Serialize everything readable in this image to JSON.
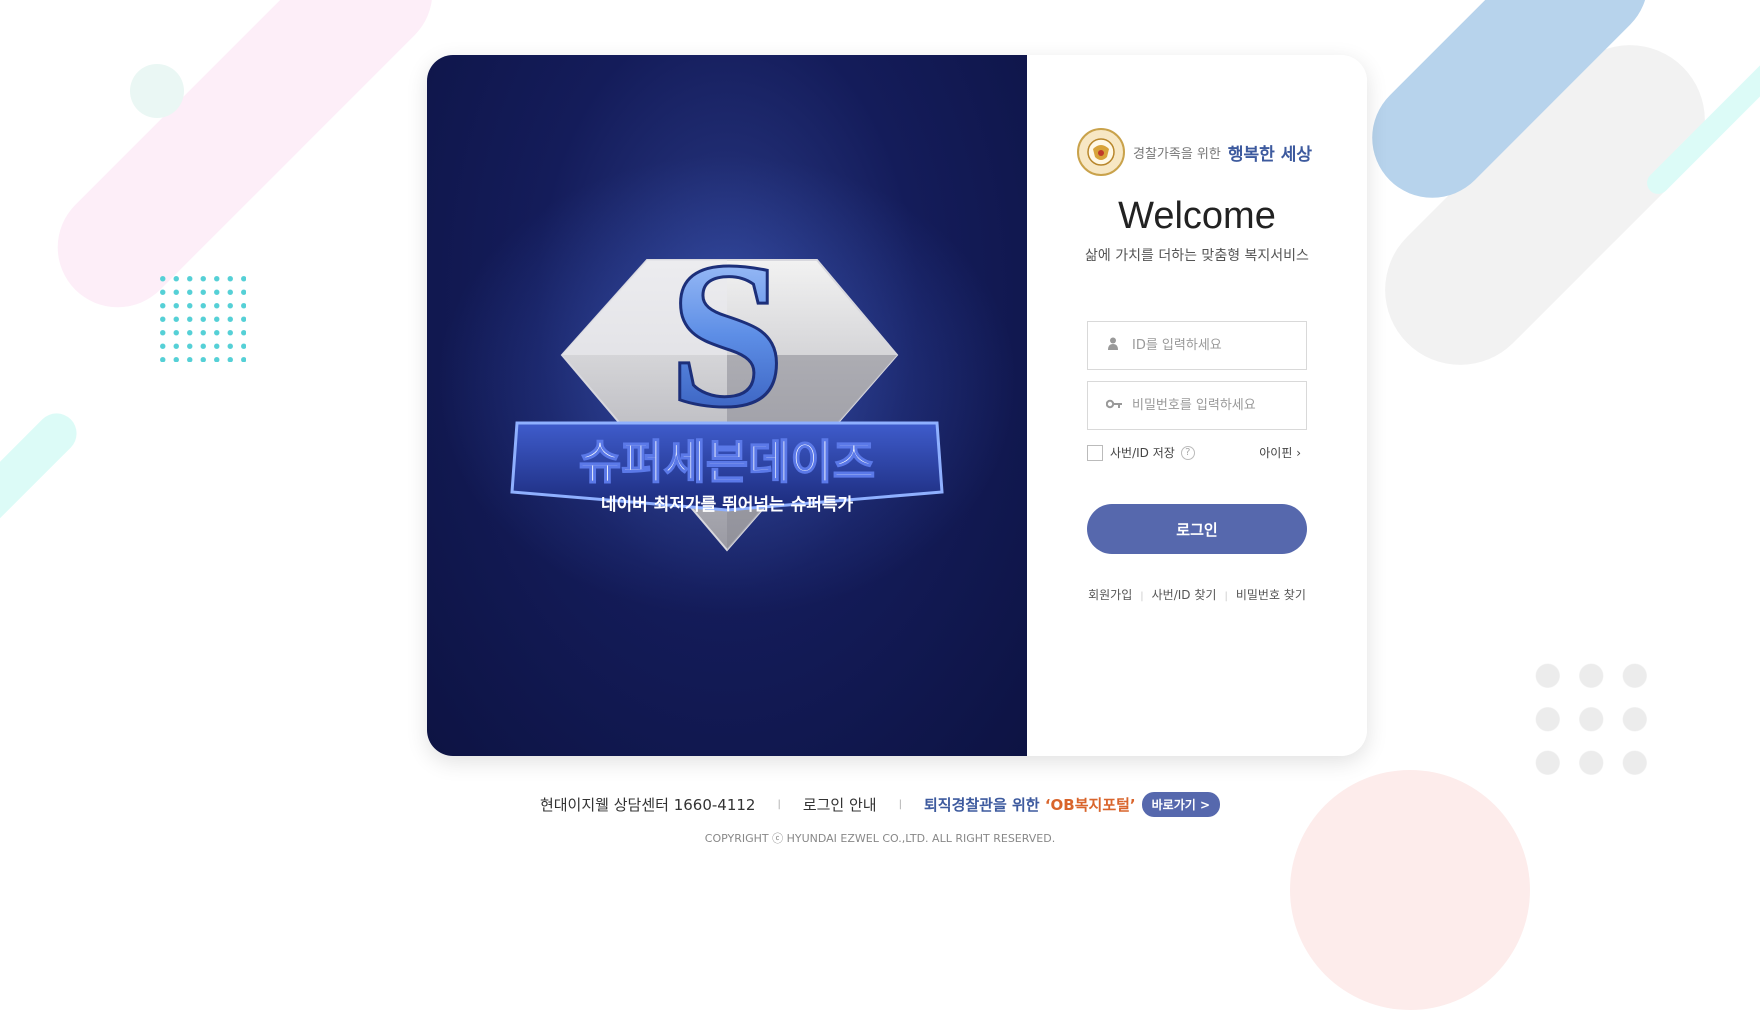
{
  "login": {
    "brand_sub": "경찰가족을 위한",
    "brand_main": "행복한 세상",
    "welcome": "Welcome",
    "tagline": "삶에 가치를 더하는 맞춤형 복지서비스",
    "id_placeholder": "ID를 입력하세요",
    "password_placeholder": "비밀번호를 입력하세요",
    "save_id_label": "사번/ID 저장",
    "help_glyph": "?",
    "ipin_label": "아이핀 ›",
    "login_button": "로그인",
    "links": [
      "회원가입",
      "사번/ID 찾기",
      "비밀번호 찾기"
    ]
  },
  "promo": {
    "logo_letter": "S",
    "title": "슈퍼세븐데이즈",
    "subtitle": "네이버 최저가를 뛰어넘는 슈퍼특가"
  },
  "footer": {
    "contact": "현대이지웰 상담센터 1660-4112",
    "login_guide": "로그인 안내",
    "ob_prefix": "퇴직경찰관을 위한 ",
    "ob_portal": "‘OB복지포털’",
    "go_button": "바로가기 >",
    "copyright": "COPYRIGHT ⓒ HYUNDAI EZWEL CO.,LTD. ALL RIGHT RESERVED."
  },
  "colors": {
    "accent": "#5668ad",
    "brand_blue": "#3d5a9e",
    "ob_orange": "#d9652c"
  },
  "icons": {
    "id_field": "user-icon",
    "password_field": "key-icon"
  }
}
